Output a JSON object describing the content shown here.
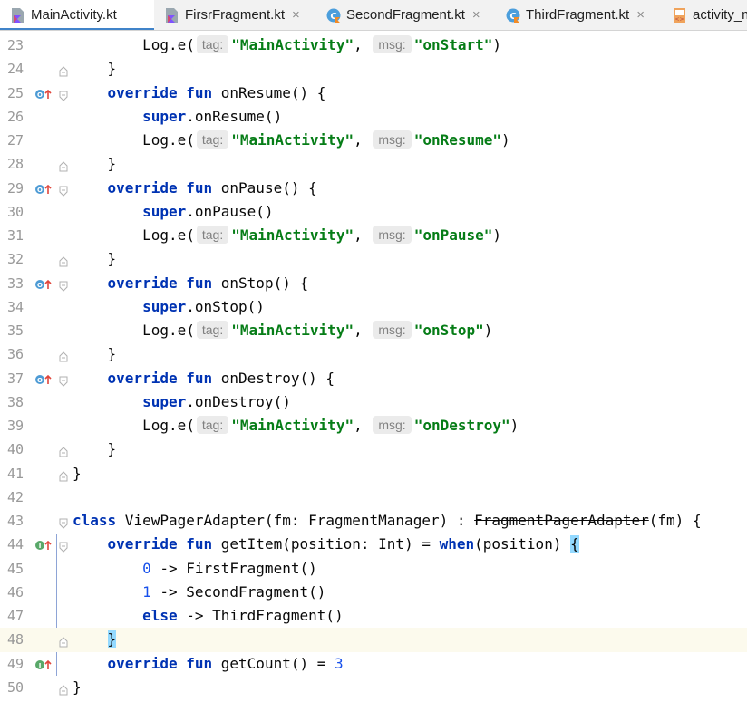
{
  "tabs": [
    {
      "label": "MainActivity.kt",
      "icon": "kotlin-file-icon",
      "active": true,
      "closable": false
    },
    {
      "label": "FirsrFragment.kt",
      "icon": "kotlin-file-icon",
      "active": false,
      "closable": true
    },
    {
      "label": "SecondFragment.kt",
      "icon": "kotlin-class-icon",
      "active": false,
      "closable": true
    },
    {
      "label": "ThirdFragment.kt",
      "icon": "kotlin-class-icon",
      "active": false,
      "closable": true
    },
    {
      "label": "activity_m",
      "icon": "xml-layout-icon",
      "active": false,
      "closable": false
    }
  ],
  "close_glyph": "×",
  "editor": {
    "current_line": "48",
    "lines": [
      {
        "n": "23",
        "indent": "        ",
        "t0": "Log.e(",
        "h1": "tag:",
        "s1": "\"MainActivity\"",
        "c1": ",",
        "h2": "msg:",
        "s2": "\"onStart\"",
        "c2": ")"
      },
      {
        "n": "24",
        "t": "    }"
      },
      {
        "n": "25",
        "indent": "    ",
        "k1": "override",
        "k2": "fun",
        "t": " onResume() {"
      },
      {
        "n": "26",
        "indent": "        ",
        "k1": "super",
        "t": ".onResume()"
      },
      {
        "n": "27",
        "indent": "        ",
        "t0": "Log.e(",
        "h1": "tag:",
        "s1": "\"MainActivity\"",
        "c1": ",",
        "h2": "msg:",
        "s2": "\"onResume\"",
        "c2": ")"
      },
      {
        "n": "28",
        "t": "    }"
      },
      {
        "n": "29",
        "indent": "    ",
        "k1": "override",
        "k2": "fun",
        "t": " onPause() {"
      },
      {
        "n": "30",
        "indent": "        ",
        "k1": "super",
        "t": ".onPause()"
      },
      {
        "n": "31",
        "indent": "        ",
        "t0": "Log.e(",
        "h1": "tag:",
        "s1": "\"MainActivity\"",
        "c1": ",",
        "h2": "msg:",
        "s2": "\"onPause\"",
        "c2": ")"
      },
      {
        "n": "32",
        "t": "    }"
      },
      {
        "n": "33",
        "indent": "    ",
        "k1": "override",
        "k2": "fun",
        "t": " onStop() {"
      },
      {
        "n": "34",
        "indent": "        ",
        "k1": "super",
        "t": ".onStop()"
      },
      {
        "n": "35",
        "indent": "        ",
        "t0": "Log.e(",
        "h1": "tag:",
        "s1": "\"MainActivity\"",
        "c1": ",",
        "h2": "msg:",
        "s2": "\"onStop\"",
        "c2": ")"
      },
      {
        "n": "36",
        "t": "    }"
      },
      {
        "n": "37",
        "indent": "    ",
        "k1": "override",
        "k2": "fun",
        "t": " onDestroy() {"
      },
      {
        "n": "38",
        "indent": "        ",
        "k1": "super",
        "t": ".onDestroy()"
      },
      {
        "n": "39",
        "indent": "        ",
        "t0": "Log.e(",
        "h1": "tag:",
        "s1": "\"MainActivity\"",
        "c1": ",",
        "h2": "msg:",
        "s2": "\"onDestroy\"",
        "c2": ")"
      },
      {
        "n": "40",
        "t": "    }"
      },
      {
        "n": "41",
        "t": "}"
      },
      {
        "n": "42",
        "t": ""
      },
      {
        "n": "43",
        "k1": "class",
        "t": " ViewPagerAdapter(fm: FragmentManager) : ",
        "strike": "FragmentPagerAdapter",
        "t2": "(fm) {"
      },
      {
        "n": "44",
        "indent": "    ",
        "k1": "override",
        "k2": "fun",
        "t": " getItem(position: Int) = ",
        "k3": "when",
        "t2": "(position) ",
        "brace": "{"
      },
      {
        "n": "45",
        "indent": "        ",
        "num": "0",
        "t": " -> FirstFragment()"
      },
      {
        "n": "46",
        "indent": "        ",
        "num": "1",
        "t": " -> SecondFragment()"
      },
      {
        "n": "47",
        "indent": "        ",
        "k1": "else",
        "t": " -> ThirdFragment()"
      },
      {
        "n": "48",
        "indent": "    ",
        "brace": "}"
      },
      {
        "n": "49",
        "indent": "    ",
        "k1": "override",
        "k2": "fun",
        "t": " getCount() = ",
        "num": "3"
      },
      {
        "n": "50",
        "t": "}"
      }
    ]
  },
  "gutter_marks": {
    "25": "override-method-icon",
    "29": "override-method-icon",
    "33": "override-method-icon",
    "37": "override-method-icon",
    "44": "implement-method-icon",
    "49": "implement-method-icon"
  },
  "fold_marks": {
    "24": "fold-end",
    "25": "fold-start",
    "28": "fold-end",
    "29": "fold-start",
    "32": "fold-end",
    "33": "fold-start",
    "36": "fold-end",
    "37": "fold-start",
    "40": "fold-end",
    "41": "fold-end",
    "43": "fold-start",
    "44": "fold-start",
    "48": "fold-end",
    "50": "fold-end"
  },
  "colors": {
    "keyword": "#0033b3",
    "string": "#067d17",
    "number": "#1750eb",
    "hint_bg": "#ebebeb",
    "current_line": "#fcfaed",
    "brace_match": "#93d9ff",
    "tab_underline": "#4083c9"
  }
}
